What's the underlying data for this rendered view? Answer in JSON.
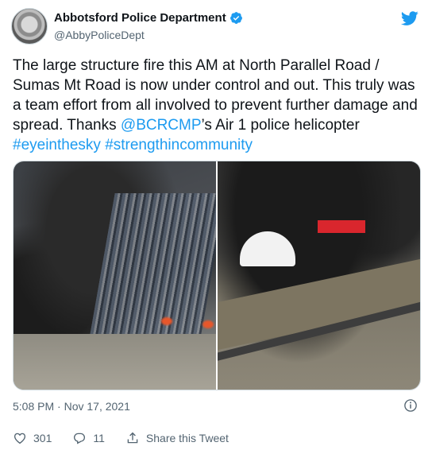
{
  "author": {
    "display_name": "Abbotsford Police Department",
    "handle": "@AbbyPoliceDept",
    "avatar_icon": "police-crest-avatar",
    "verified": true
  },
  "brand": {
    "logo_icon": "twitter-bird-icon",
    "accent_color": "#1d9bf0"
  },
  "tweet": {
    "text_part1": "The large structure fire this AM at North Parallel Road / Sumas Mt Road is now under control and out.  This truly was a team effort from all involved to prevent further damage and spread.  Thanks ",
    "mention": "@BCRCMP",
    "text_part2": "’s Air 1 police helicopter ",
    "hashtag1": "#eyeinthesky",
    "space": " ",
    "hashtag2": "#strengthincommunity"
  },
  "media": {
    "photos": [
      {
        "icon": "aerial-photo-smoke-over-lot"
      },
      {
        "icon": "aerial-photo-smoke-over-warehouse"
      }
    ]
  },
  "meta": {
    "timestamp": "5:08 PM · Nov 17, 2021"
  },
  "actions": {
    "like_count": "301",
    "reply_count": "11",
    "share_label": "Share this Tweet"
  }
}
